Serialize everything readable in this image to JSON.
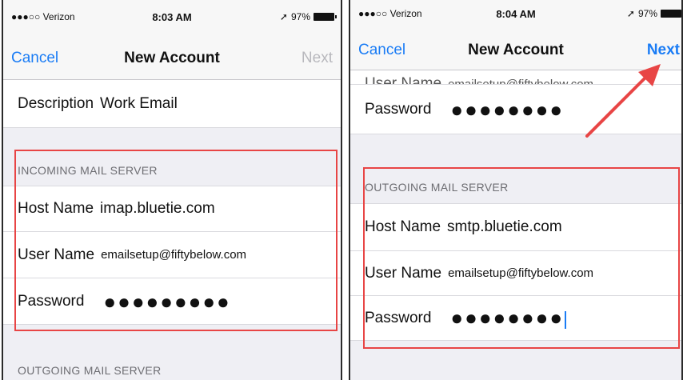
{
  "left": {
    "status": {
      "carrier": "●●●○○ Verizon",
      "time": "8:03 AM",
      "battery": "97%"
    },
    "nav": {
      "cancel": "Cancel",
      "title": "New Account",
      "next": "Next"
    },
    "description_row": {
      "label": "Description",
      "value": "Work Email"
    },
    "incoming": {
      "header": "INCOMING MAIL SERVER",
      "host": {
        "label": "Host Name",
        "value": "imap.bluetie.com"
      },
      "user": {
        "label": "User Name",
        "value": "emailsetup@fiftybelow.com"
      },
      "password": {
        "label": "Password",
        "value": "●●●●●●●●●"
      }
    },
    "outgoing_header": "OUTGOING MAIL SERVER"
  },
  "right": {
    "status": {
      "carrier": "●●●○○ Verizon",
      "time": "8:04 AM",
      "battery": "97%"
    },
    "nav": {
      "cancel": "Cancel",
      "title": "New Account",
      "next": "Next"
    },
    "partial_row": {
      "label": "User Name",
      "value": "emailsetup@fiftybelow.com"
    },
    "password_row": {
      "label": "Password",
      "value": "●●●●●●●●"
    },
    "outgoing": {
      "header": "OUTGOING MAIL SERVER",
      "host": {
        "label": "Host Name",
        "value": "smtp.bluetie.com"
      },
      "user": {
        "label": "User Name",
        "value": "emailsetup@fiftybelow.com"
      },
      "password": {
        "label": "Password",
        "value": "●●●●●●●●"
      }
    }
  },
  "colors": {
    "accent": "#1a7cf5",
    "highlight": "#e84545",
    "background": "#efeff4"
  }
}
